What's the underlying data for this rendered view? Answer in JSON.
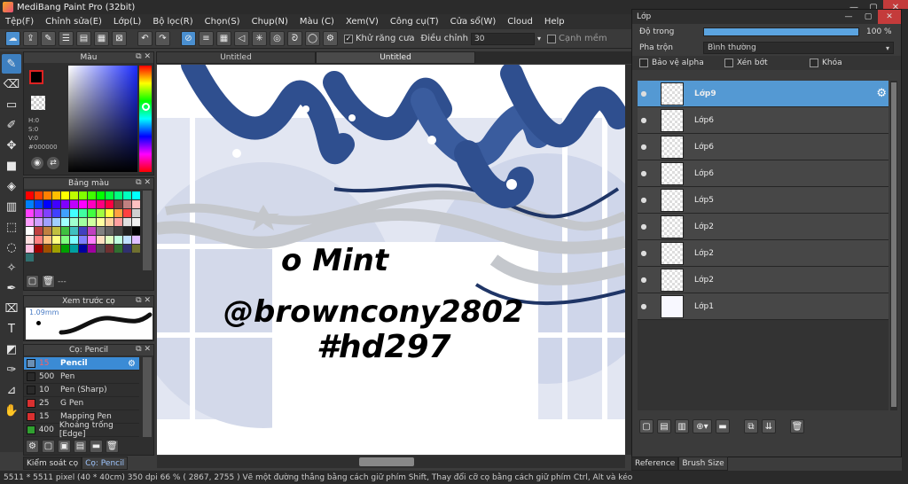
{
  "app": {
    "title": "MediBang Paint Pro (32bit)"
  },
  "menu": [
    "Tệp(F)",
    "Chỉnh sửa(E)",
    "Lớp(L)",
    "Bộ lọc(R)",
    "Chọn(S)",
    "Chụp(N)",
    "Màu (C)",
    "Xem(V)",
    "Công cụ(T)",
    "Cửa sổ(W)",
    "Cloud",
    "Help"
  ],
  "toolbar": {
    "antialias_label": "Khử răng cưa",
    "antialias_checked": true,
    "adjust_label": "Điều chỉnh",
    "adjust_value": "30",
    "snap_label": "Cạnh mềm",
    "snap_checked": false
  },
  "color_panel": {
    "title": "Màu",
    "h": "H:0",
    "s": "S:0",
    "v": "V:0",
    "hex": "#000000",
    "fg_color": "#000000",
    "bg_color": "#ffffff"
  },
  "palette_panel": {
    "title": "Bảng màu",
    "footer_text": "---",
    "colors": [
      "#ff0000",
      "#ff4000",
      "#ff8000",
      "#ffbf00",
      "#ffff00",
      "#bfff00",
      "#80ff00",
      "#40ff00",
      "#00ff00",
      "#00ff40",
      "#00ff80",
      "#00ffbf",
      "#00ffff",
      "#0080ff",
      "#0040ff",
      "#0000ff",
      "#4000ff",
      "#8000ff",
      "#bf00ff",
      "#ff00ff",
      "#ff00bf",
      "#ff0080",
      "#ff0040",
      "#804040",
      "#c08080",
      "#ffc0c0",
      "#ff40ff",
      "#c040ff",
      "#8040ff",
      "#4040ff",
      "#40a0ff",
      "#40ffff",
      "#40ffa0",
      "#40ff40",
      "#a0ff40",
      "#ffff40",
      "#ffa040",
      "#ff4040",
      "#d0d0d0",
      "#ffa0ff",
      "#d0a0ff",
      "#a0a0ff",
      "#a0d0ff",
      "#a0ffff",
      "#a0ffd0",
      "#a0ffa0",
      "#d0ffa0",
      "#ffffa0",
      "#ffd0a0",
      "#ffa0a0",
      "#e0e0e0",
      "#f0f0f0",
      "#ffffff",
      "#c04040",
      "#c08040",
      "#c0c040",
      "#40c040",
      "#40c0c0",
      "#4040c0",
      "#c040c0",
      "#808080",
      "#606060",
      "#404040",
      "#202020",
      "#000000",
      "#ffe0e0",
      "#ff8080",
      "#ffc080",
      "#ffff80",
      "#80ff80",
      "#80ffff",
      "#8080ff",
      "#ff80ff",
      "#ffe0c0",
      "#e0ffc0",
      "#c0ffe0",
      "#c0e0ff",
      "#e0c0ff",
      "#ffc0e0",
      "#a00000",
      "#a05000",
      "#a0a000",
      "#00a000",
      "#00a0a0",
      "#0000a0",
      "#a000a0",
      "#505050",
      "#703030",
      "#307030",
      "#303070",
      "#707030",
      "#307070"
    ]
  },
  "brush_preview_panel": {
    "title": "Xem trước cọ",
    "size": "1.09mm"
  },
  "brush_panel": {
    "title": "Cọ: Pencil",
    "brushes": [
      {
        "size": "15",
        "name": "Pencil",
        "color": "#6a8fb5",
        "selected": true
      },
      {
        "size": "500",
        "name": "Pen",
        "color": "#2a2a2a",
        "selected": false
      },
      {
        "size": "10",
        "name": "Pen (Sharp)",
        "color": "#2a2a2a",
        "selected": false
      },
      {
        "size": "25",
        "name": "G Pen",
        "color": "#d93030",
        "selected": false
      },
      {
        "size": "15",
        "name": "Mapping Pen",
        "color": "#d93030",
        "selected": false
      },
      {
        "size": "400",
        "name": "Khoảng trống [Edge]",
        "color": "#30a030",
        "selected": false
      }
    ]
  },
  "left_tabs": [
    "Kiểm soát cọ",
    "Cọ: Pencil"
  ],
  "document_tabs": [
    "Untitled",
    "Untitled"
  ],
  "canvas": {
    "signature_lines": [
      "o Mint",
      "@browncony2802",
      "#hd297"
    ]
  },
  "layer_panel": {
    "title": "Lớp",
    "opacity_label": "Độ trong",
    "opacity_value": "100 %",
    "opacity_fraction": 1.0,
    "blend_label": "Pha trộn",
    "blend_value": "Bình thường",
    "protect_alpha": "Bảo vệ alpha",
    "clipping": "Xén bớt",
    "lock": "Khóa",
    "layers": [
      {
        "name": "Lớp9",
        "selected": true
      },
      {
        "name": "Lớp6",
        "selected": false
      },
      {
        "name": "Lớp6",
        "selected": false
      },
      {
        "name": "Lớp6",
        "selected": false
      },
      {
        "name": "Lớp5",
        "selected": false
      },
      {
        "name": "Lớp2",
        "selected": false
      },
      {
        "name": "Lớp2",
        "selected": false
      },
      {
        "name": "Lớp2",
        "selected": false
      },
      {
        "name": "Lớp1",
        "selected": false
      }
    ],
    "bottom_tabs": [
      "Reference",
      "Brush Size"
    ]
  },
  "status": {
    "text": "5511 * 5511 pixel  (40 * 40cm)  350 dpi  66 %  ( 2867, 2755 )  Vẽ một đường thẳng bằng cách giữ phím Shift, Thay đổi cỡ cọ bằng cách giữ phím Ctrl, Alt và kéo"
  }
}
